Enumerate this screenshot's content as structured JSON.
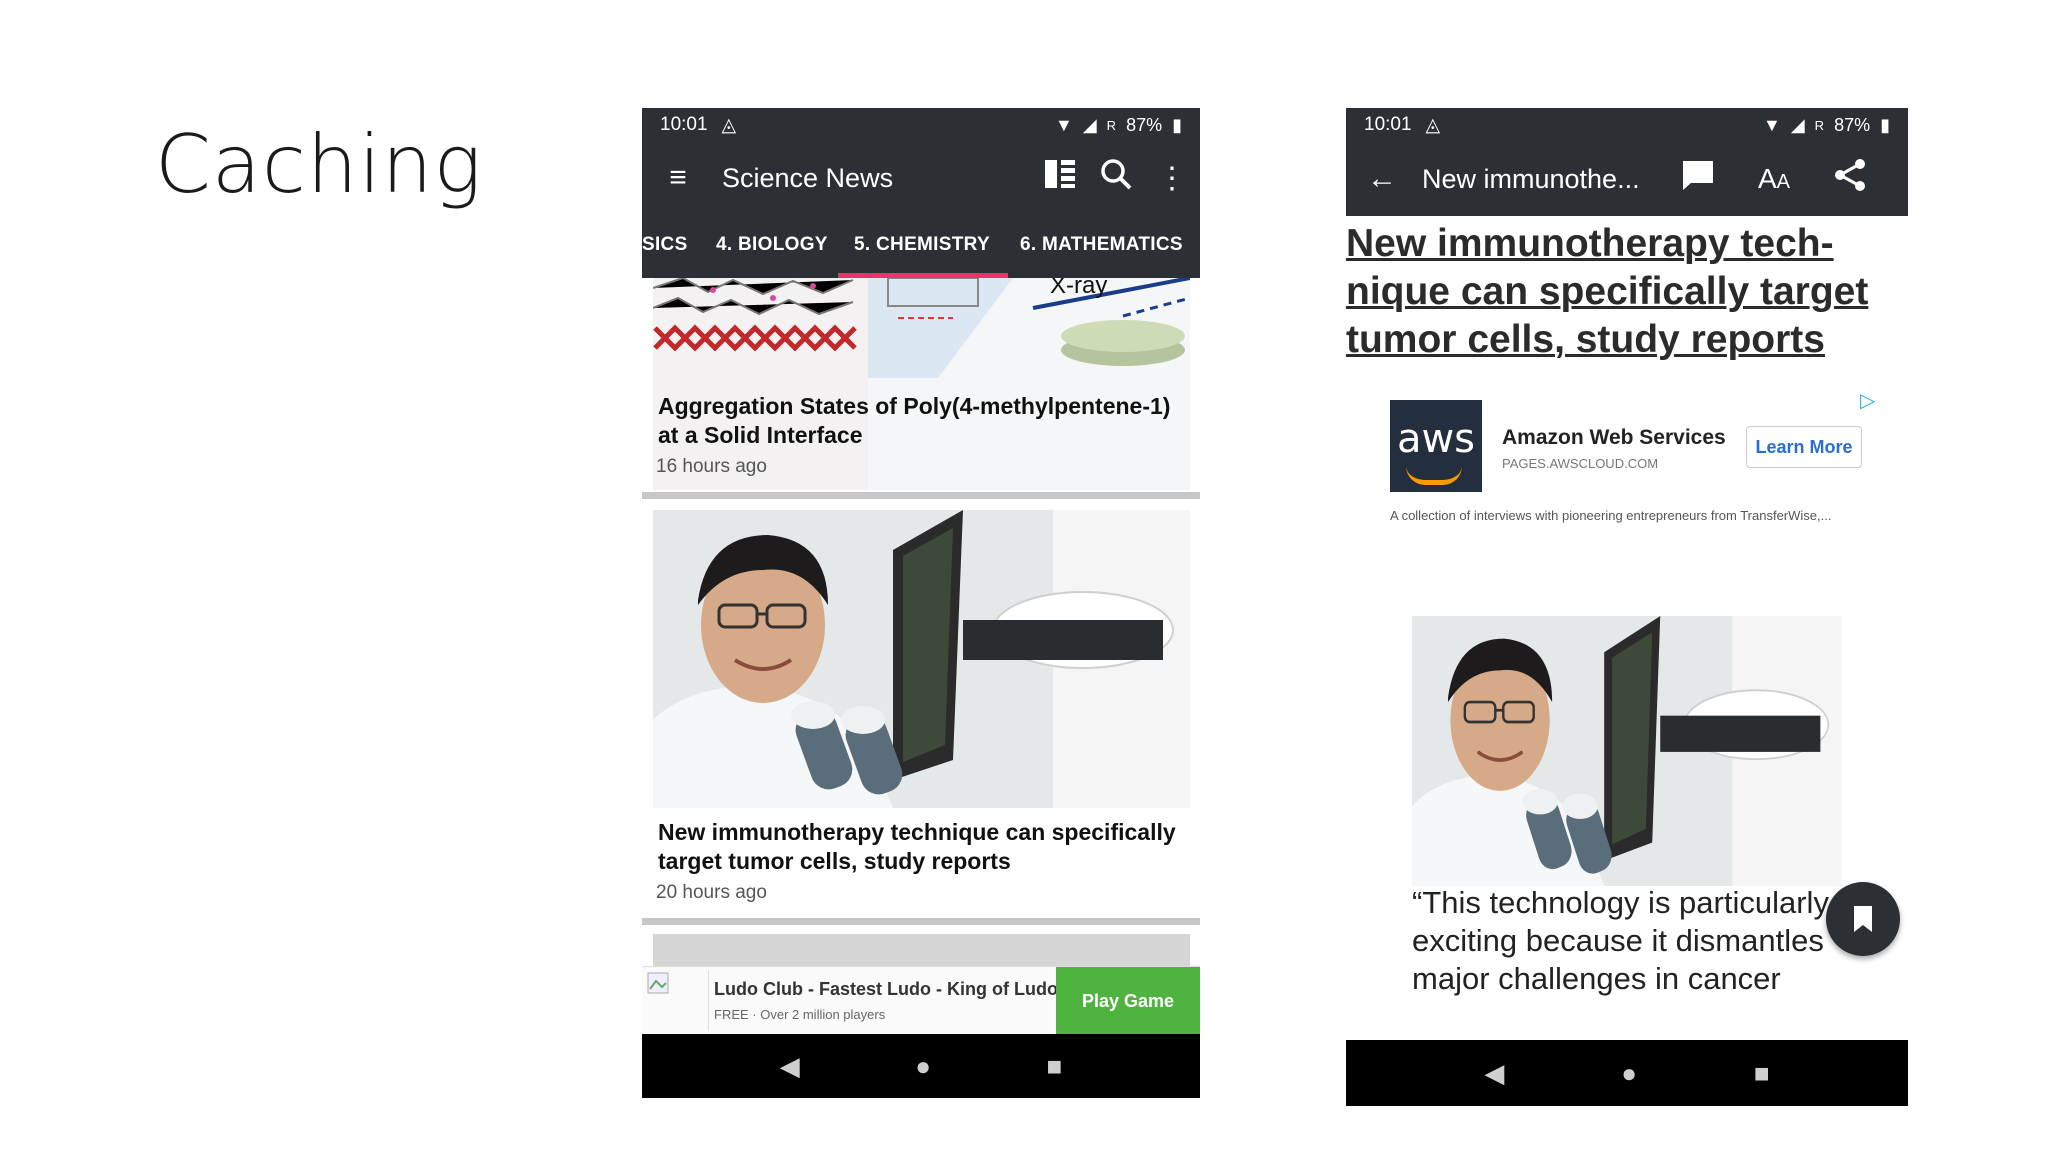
{
  "slide": {
    "title": "Caching"
  },
  "left_phone": {
    "status": {
      "time": "10:01",
      "battery": "87%"
    },
    "app_bar": {
      "title": "Science News"
    },
    "tabs": [
      {
        "label": "SICS"
      },
      {
        "label": "4. BIOLOGY"
      },
      {
        "label": "5. CHEMISTRY",
        "selected": true
      },
      {
        "label": "6. MATHEMATICS"
      }
    ],
    "hero_label": "X-ray",
    "articles": [
      {
        "title": "Aggregation States of Poly(4-methylpentene-1) at a Solid Interface",
        "time": "16 hours ago"
      },
      {
        "title": "New immunotherapy technique can specifically target tumor cells, study reports",
        "time": "20 hours ago"
      }
    ],
    "ad": {
      "title": "Ludo Club - Fastest Ludo - King of Ludo",
      "subtitle": "FREE · Over 2 million players",
      "button": "Play Game"
    }
  },
  "right_phone": {
    "status": {
      "time": "10:01",
      "battery": "87%"
    },
    "app_bar": {
      "title": "New immunothe..."
    },
    "article_title": "New immunotherapy tech-nique can specifically target tumor cells, study reports",
    "ad": {
      "logo": "aws",
      "name": "Amazon Web Services",
      "url": "PAGES.AWSCLOUD.COM",
      "button": "Learn More",
      "description": "A collection of interviews with pioneering entrepreneurs from TransferWise,..."
    },
    "quote": "“This technology is particularly exciting because it dismantles major challenges in cancer"
  },
  "colors": {
    "app_bar": "#2c2f33",
    "tab_indicator": "#e8336d",
    "ad_button": "#4fb43f",
    "aws_orange": "#ff9900"
  }
}
